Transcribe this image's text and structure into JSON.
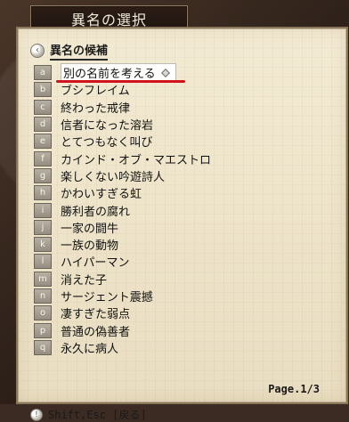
{
  "window": {
    "title": "異名の選択"
  },
  "section": {
    "title": "異名の候補"
  },
  "options": [
    {
      "key": "a",
      "label": "別の名前を考える",
      "selected": true
    },
    {
      "key": "b",
      "label": "ブシフレイム"
    },
    {
      "key": "c",
      "label": "終わった戒律"
    },
    {
      "key": "d",
      "label": "信者になった溶岩"
    },
    {
      "key": "e",
      "label": "とてつもなく叫び"
    },
    {
      "key": "f",
      "label": "カインド・オブ・マエストロ"
    },
    {
      "key": "g",
      "label": "楽しくない吟遊詩人"
    },
    {
      "key": "h",
      "label": "かわいすぎる虹"
    },
    {
      "key": "i",
      "label": "勝利者の腐れ"
    },
    {
      "key": "j",
      "label": "一家の闘牛"
    },
    {
      "key": "k",
      "label": "一族の動物"
    },
    {
      "key": "l",
      "label": "ハイパーマン"
    },
    {
      "key": "m",
      "label": "消えた子"
    },
    {
      "key": "n",
      "label": "サージェント震撼"
    },
    {
      "key": "o",
      "label": "凄すぎた弱点"
    },
    {
      "key": "p",
      "label": "普通の偽善者"
    },
    {
      "key": "q",
      "label": "永久に病人"
    }
  ],
  "pagination": {
    "label": "Page.1/3"
  },
  "footer": {
    "hint": "Shift,Esc [戻る]"
  },
  "icons": {
    "section_icon": "left-arrow-circle-icon",
    "selected_marker": "diamond-icon",
    "footer_icon": "keyboard-hint-icon"
  },
  "colors": {
    "background": "#3b2b22",
    "panel": "#efe5cb",
    "panel_border": "#8a7659",
    "accent_underline": "#d1131b"
  }
}
